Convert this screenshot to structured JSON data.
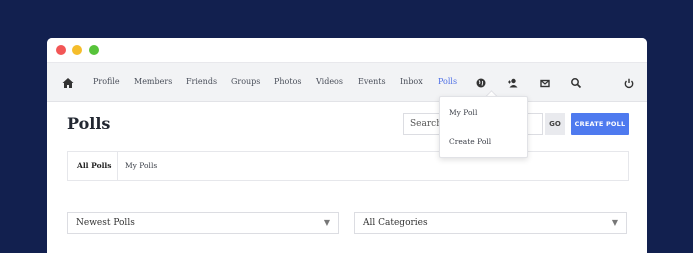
{
  "nav": {
    "items": [
      {
        "label": "Profile"
      },
      {
        "label": "Members"
      },
      {
        "label": "Friends"
      },
      {
        "label": "Groups"
      },
      {
        "label": "Photos"
      },
      {
        "label": "Videos"
      },
      {
        "label": "Events"
      },
      {
        "label": "Inbox"
      },
      {
        "label": "Polls",
        "active": true
      }
    ],
    "icons": [
      "home-icon",
      "globe-icon",
      "user-add-icon",
      "mail-icon",
      "search-icon",
      "power-icon"
    ]
  },
  "page": {
    "title": "Polls"
  },
  "search": {
    "placeholder": "Search",
    "go_label": "GO"
  },
  "create_button": {
    "label": "CREATE POLL"
  },
  "dropdown": {
    "items": [
      {
        "label": "My Poll"
      },
      {
        "label": "Create Poll"
      }
    ]
  },
  "tabs": [
    {
      "label": "All Polls",
      "active": true
    },
    {
      "label": "My Polls"
    }
  ],
  "filters": {
    "sort": {
      "value": "Newest Polls"
    },
    "category": {
      "value": "All Categories"
    }
  },
  "colors": {
    "accent": "#4e7aef",
    "background": "#12204f",
    "active_nav": "#4d6fe6"
  }
}
